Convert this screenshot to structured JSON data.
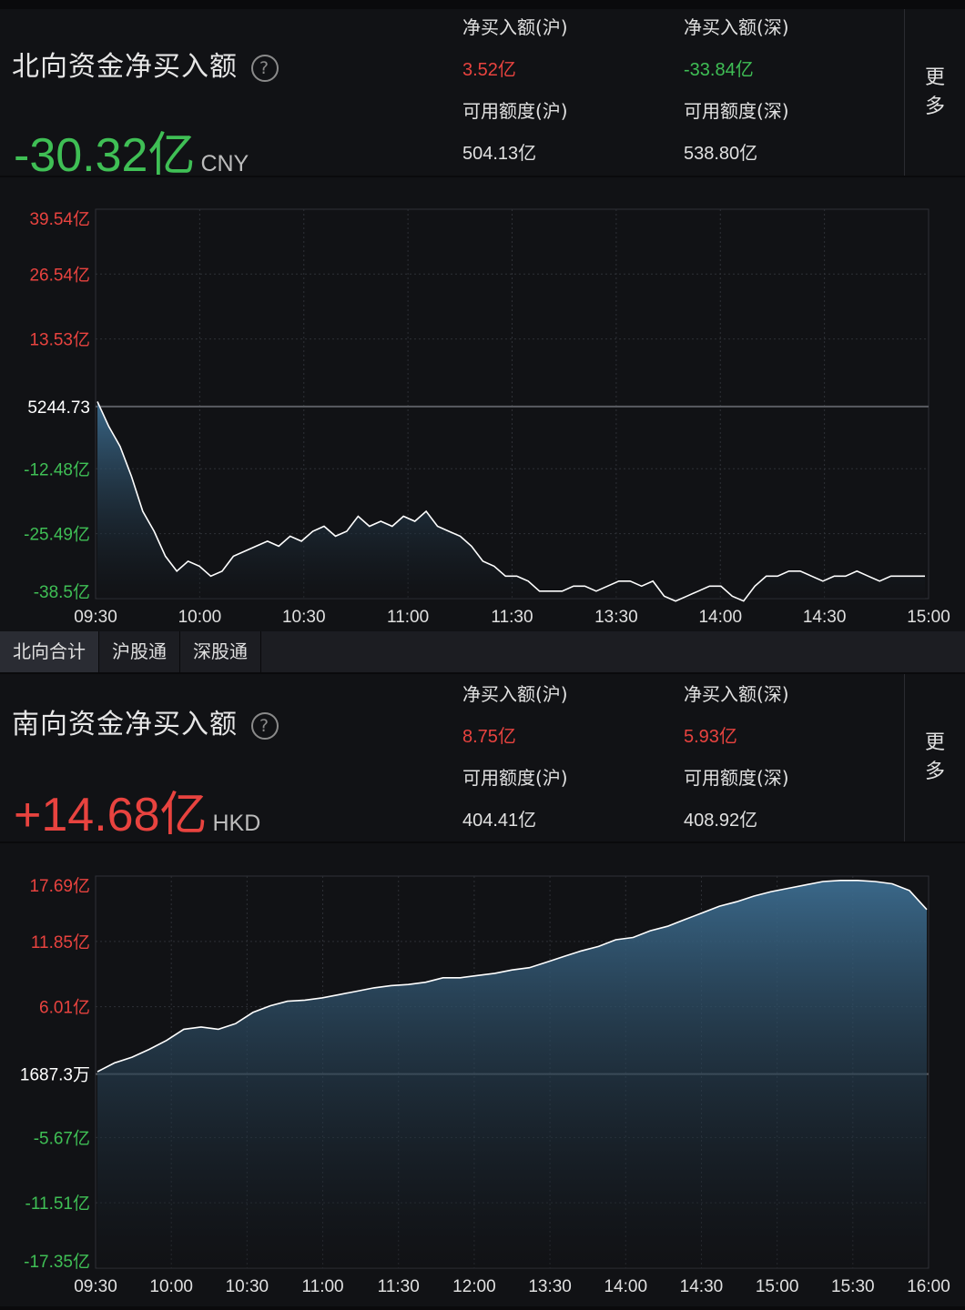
{
  "north": {
    "title": "北向资金净买入额",
    "help": "?",
    "value": "-30.32亿",
    "currency": "CNY",
    "net_sh_label": "净买入额(沪)",
    "net_sh_value": "3.52亿",
    "net_sz_label": "净买入额(深)",
    "net_sz_value": "-33.84亿",
    "quota_sh_label": "可用额度(沪)",
    "quota_sh_value": "504.13亿",
    "quota_sz_label": "可用额度(深)",
    "quota_sz_value": "538.80亿",
    "more": [
      "更",
      "多"
    ]
  },
  "tabs": [
    "北向合计",
    "沪股通",
    "深股通"
  ],
  "south": {
    "title": "南向资金净买入额",
    "help": "?",
    "value": "+14.68亿",
    "currency": "HKD",
    "net_sh_label": "净买入额(沪)",
    "net_sh_value": "8.75亿",
    "net_sz_label": "净买入额(深)",
    "net_sz_value": "5.93亿",
    "quota_sh_label": "可用额度(沪)",
    "quota_sh_value": "404.41亿",
    "quota_sz_label": "可用额度(深)",
    "quota_sz_value": "408.92亿",
    "more": [
      "更",
      "多"
    ]
  },
  "colors": {
    "up": "#e8433f",
    "down": "#3fbf55",
    "line": "#ffffff",
    "fill_top": "#3c6c8f",
    "grid": "#2e3036",
    "zero_line": "#5a5c62"
  },
  "chart_data": [
    {
      "type": "area",
      "x_ticks": [
        "09:30",
        "10:00",
        "10:30",
        "11:00",
        "11:30",
        "13:30",
        "14:00",
        "14:30",
        "15:00"
      ],
      "y_ticks": [
        "39.54亿",
        "26.54亿",
        "13.53亿",
        "5244.73",
        "-12.48亿",
        "-25.49亿",
        "-38.5亿"
      ],
      "ylim": [
        -38.5,
        39.54
      ],
      "y": [
        1,
        -4,
        -8,
        -14,
        -21,
        -25,
        -30,
        -33,
        -31,
        -32,
        -34,
        -33,
        -30,
        -29,
        -28,
        -27,
        -28,
        -26,
        -27,
        -25,
        -24,
        -26,
        -25,
        -22,
        -24,
        -23,
        -24,
        -22,
        -23,
        -21,
        -24,
        -25,
        -26,
        -28,
        -31,
        -32,
        -34,
        -34,
        -35,
        -37,
        -37,
        -37,
        -36,
        -36,
        -37,
        -36,
        -35,
        -35,
        -36,
        -35,
        -38,
        -39,
        -38,
        -37,
        -36,
        -36,
        -38,
        -39,
        -36,
        -34,
        -34,
        -33,
        -33,
        -34,
        -35,
        -34,
        -34,
        -33,
        -34,
        -35,
        -34,
        -34,
        -34,
        -34
      ]
    },
    {
      "type": "area",
      "x_ticks": [
        "09:30",
        "10:00",
        "10:30",
        "11:00",
        "11:30",
        "12:00",
        "13:30",
        "14:00",
        "14:30",
        "15:00",
        "15:30",
        "16:00"
      ],
      "y_ticks": [
        "17.69亿",
        "11.85亿",
        "6.01亿",
        "1687.3万",
        "-5.67亿",
        "-11.51亿",
        "-17.35亿"
      ],
      "ylim": [
        -17.35,
        17.69
      ],
      "y": [
        0.2,
        1.0,
        1.5,
        2.2,
        3.0,
        4.0,
        4.2,
        4.0,
        4.5,
        5.5,
        6.1,
        6.5,
        6.6,
        6.8,
        7.1,
        7.4,
        7.7,
        7.9,
        8.0,
        8.2,
        8.6,
        8.6,
        8.8,
        9.0,
        9.3,
        9.5,
        10.0,
        10.5,
        11.0,
        11.4,
        12.0,
        12.2,
        12.8,
        13.2,
        13.8,
        14.4,
        15.0,
        15.4,
        15.9,
        16.3,
        16.6,
        16.9,
        17.2,
        17.3,
        17.3,
        17.2,
        17.0,
        16.4,
        14.7
      ]
    }
  ]
}
